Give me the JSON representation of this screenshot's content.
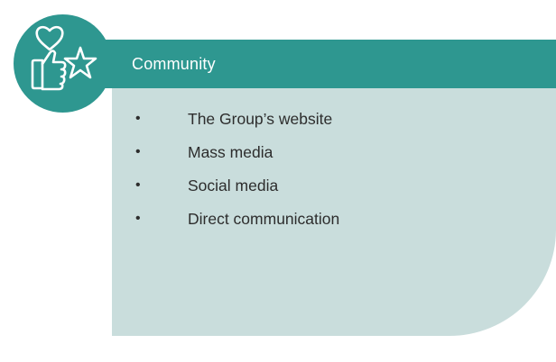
{
  "header": {
    "title": "Community",
    "icon": "heart-thumbs-up-star-icon"
  },
  "list": {
    "bullet": "•",
    "items": [
      "The Group’s website",
      "Mass media",
      "Social media",
      "Direct communication"
    ]
  },
  "colors": {
    "teal": "#2e9790",
    "card_background": "#c9dddc",
    "text": "#2d2d2d",
    "header_text": "#ffffff"
  }
}
